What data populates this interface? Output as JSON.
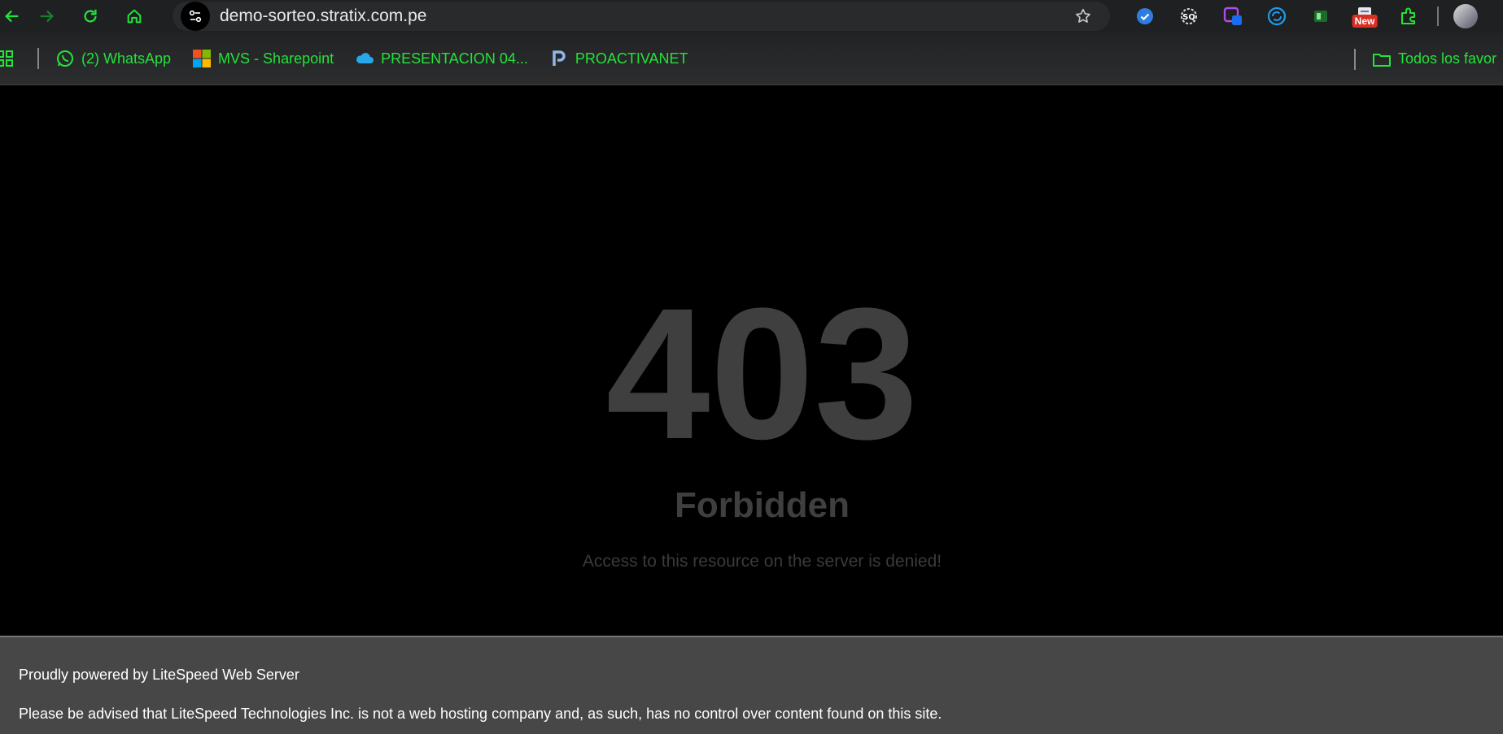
{
  "browser": {
    "url": "demo-sorteo.stratix.com.pe",
    "accent_color": "#22e33a",
    "nav": {
      "back_icon": "arrow-left-icon",
      "forward_icon": "arrow-right-icon",
      "reload_icon": "reload-icon",
      "home_icon": "home-icon"
    },
    "extensions": [
      {
        "icon": "checkmark-shield-icon"
      },
      {
        "icon": "seo-gear-icon"
      },
      {
        "icon": "screen-capture-icon"
      },
      {
        "icon": "sync-icon"
      },
      {
        "icon": "spreadsheet-icon"
      },
      {
        "icon": "new-extension-icon",
        "badge": "New"
      },
      {
        "icon": "puzzle-icon"
      }
    ]
  },
  "bookmarks": {
    "items": [
      {
        "label": "(2) WhatsApp",
        "icon": "whatsapp-icon"
      },
      {
        "label": "MVS - Sharepoint",
        "icon": "microsoft-icon"
      },
      {
        "label": "PRESENTACION 04...",
        "icon": "onedrive-cloud-icon"
      },
      {
        "label": "PROACTIVANET",
        "icon": "proactivanet-icon"
      }
    ],
    "all_favorites": "Todos los favor"
  },
  "page": {
    "code": "403",
    "status": "Forbidden",
    "message": "Access to this resource on the server is denied!",
    "footer_line1": "Proudly powered by LiteSpeed Web Server",
    "footer_line2": "Please be advised that LiteSpeed Technologies Inc. is not a web hosting company and, as such, has no control over content found on this site."
  }
}
